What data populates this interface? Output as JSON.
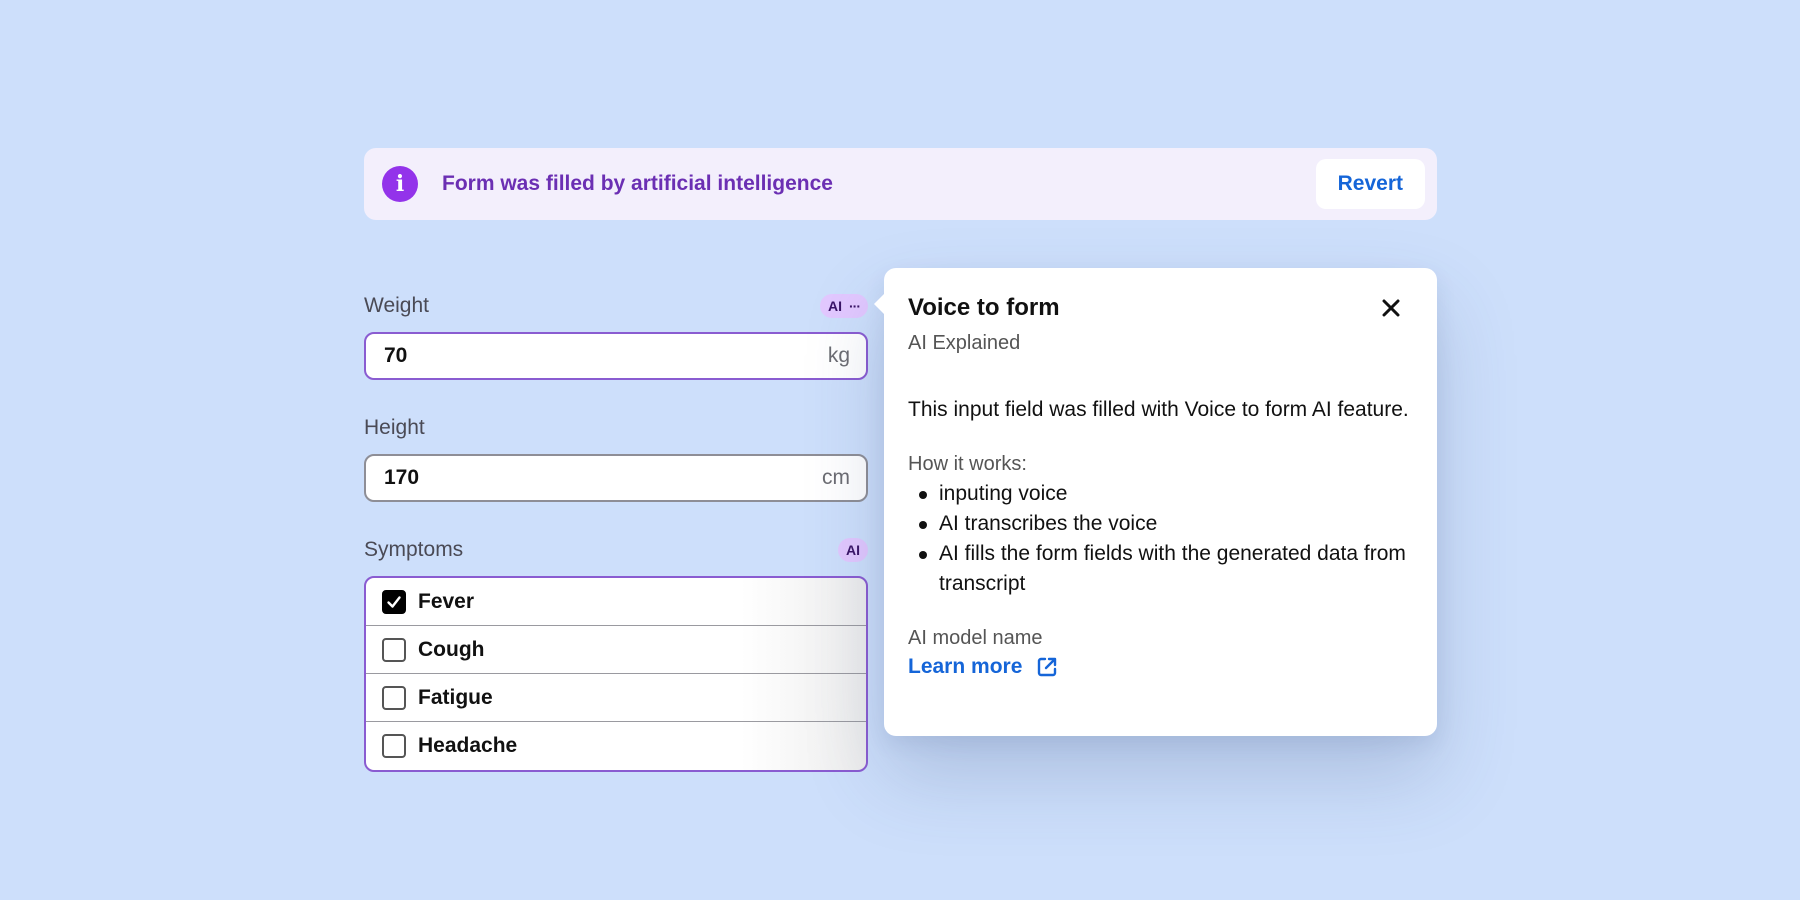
{
  "banner": {
    "icon": "info-icon",
    "message": "Form was filled by artificial intelligence",
    "revert_label": "Revert"
  },
  "form": {
    "weight": {
      "label": "Weight",
      "value": "70",
      "unit": "kg",
      "badge": "AI",
      "badge_more": "···"
    },
    "height": {
      "label": "Height",
      "value": "170",
      "unit": "cm"
    },
    "symptoms": {
      "label": "Symptoms",
      "badge": "AI",
      "items": [
        {
          "label": "Fever",
          "checked": true
        },
        {
          "label": "Cough",
          "checked": false
        },
        {
          "label": "Fatigue",
          "checked": false
        },
        {
          "label": "Headache",
          "checked": false
        }
      ]
    }
  },
  "popover": {
    "title": "Voice to form",
    "subtitle": "AI Explained",
    "description": "This input field was filled with Voice to form AI feature.",
    "how_title": "How it works:",
    "steps": [
      "inputing voice",
      "AI transcribes the voice",
      "AI fills the form fields with the generated data from transcript"
    ],
    "model_label": "AI model name",
    "learn_more": "Learn more"
  },
  "colors": {
    "background": "#cddffb",
    "ai_accent": "#8a5cd1",
    "banner_text": "#6b2fb3",
    "link": "#1565d8"
  }
}
